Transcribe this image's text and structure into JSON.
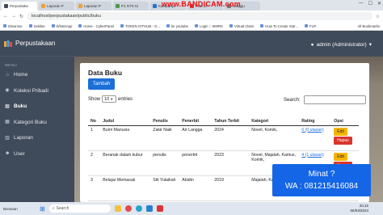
{
  "browser": {
    "tabs": [
      {
        "label": "Perpustaka",
        "active": true,
        "color": "#3f4a5a"
      },
      {
        "label": "Laporan P",
        "active": false,
        "color": "#e8a33a"
      },
      {
        "label": "Laporan P",
        "active": false,
        "color": "#e8a33a"
      },
      {
        "label": "P1 GTK Ki",
        "active": false,
        "color": "#4c9a4c"
      },
      {
        "label": "Kampanye",
        "active": false,
        "color": "#2a6fd0"
      },
      {
        "label": "How to",
        "active": false,
        "color": "#d33"
      },
      {
        "label": "sanggu",
        "active": false,
        "color": "#777"
      }
    ],
    "recorder_watermark": "www.BANDICAM.com",
    "url": "localhost/perpustakaan/public/buku",
    "bookmarks": [
      "Diswrose",
      "Sekilas",
      "WhatsApp",
      "Home - CyberPanel",
      "TOKEN GITHUB - G...",
      "ke youtube",
      "Login :: SIMRS",
      "Virtual Claim",
      "How To Create Star...",
      "FLR"
    ],
    "all_bookmarks": "All Bookmarks"
  },
  "app": {
    "brand": "Perpustakaan",
    "user": "admin (Administrator)",
    "menu_heading": "MENU",
    "menu": [
      {
        "label": "Home",
        "icon": "home-icon",
        "glyph": "⌂",
        "active": false
      },
      {
        "label": "Koleksi Pribadi",
        "icon": "collection-icon",
        "glyph": "◉",
        "active": false
      },
      {
        "label": "Buku",
        "icon": "book-icon",
        "glyph": "▤",
        "active": true
      },
      {
        "label": "Kategori Buku",
        "icon": "category-icon",
        "glyph": "▦",
        "active": false
      },
      {
        "label": "Laporan",
        "icon": "report-icon",
        "glyph": "▥",
        "active": false
      },
      {
        "label": "User",
        "icon": "user-icon",
        "glyph": "☻",
        "active": false
      }
    ]
  },
  "page": {
    "title": "Data Buku",
    "add_button": "Tambah",
    "show_label": "Show",
    "entries_value": "10",
    "entries_label": "entries",
    "search_label": "Search:",
    "table": {
      "headers": [
        "No",
        "Judul",
        "Penulis",
        "Penerbit",
        "Tahun Terbit",
        "Kategori",
        "Rating",
        "Opsi"
      ],
      "rows": [
        {
          "no": "1",
          "judul": "Bumi Manusia",
          "penulis": "Zakir Naik",
          "penerbit": "Air Langga",
          "tahun": "2024",
          "kategori": "Novel, Komik,",
          "rating": "0 (0 ulasan)"
        },
        {
          "no": "2",
          "judul": "Beranak dalam kubur",
          "penulis": "penulis",
          "penerbit": "penerbit",
          "tahun": "2023",
          "kategori": "Novel, Majalah, Kamus, Komik,",
          "rating": "4 (1 ulasan)"
        },
        {
          "no": "3",
          "judul": "Belajar Memasak",
          "penulis": "Siti Yulaikah",
          "penerbit": "Abidin",
          "tahun": "2019",
          "kategori": "Majalah, Kamus,",
          "rating": ""
        }
      ],
      "edit_label": "Edit",
      "delete_label": "Hapus"
    }
  },
  "promo": {
    "line1": "Minat ?",
    "line2": "WA : 081215416084"
  },
  "taskbar": {
    "weather": "Berawan",
    "search_placeholder": "Search",
    "time": "20.22",
    "date": "06/03/2024"
  },
  "colors": {
    "sidebar": "#3f4a5a",
    "primary": "#1a6fd8",
    "edit": "#f5b400",
    "delete": "#d9342b",
    "promo": "#1466e6"
  }
}
